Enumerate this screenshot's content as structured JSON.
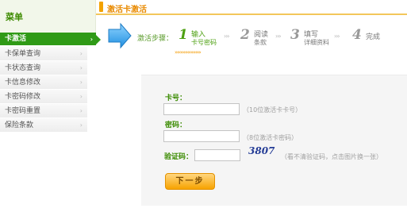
{
  "sidebar": {
    "title": "菜单",
    "items": [
      {
        "label": "卡激活"
      },
      {
        "label": "卡保单查询"
      },
      {
        "label": "卡状态查询"
      },
      {
        "label": "卡信息修改"
      },
      {
        "label": "卡密码修改"
      },
      {
        "label": "卡密码重置"
      },
      {
        "label": "保险条款"
      }
    ]
  },
  "header": {
    "title": "激活卡激活"
  },
  "steps": {
    "label": "激活步骤：",
    "items": [
      {
        "num": "1",
        "line1": "输入",
        "line2": "卡号密码"
      },
      {
        "num": "2",
        "line1": "阅读",
        "line2": "条款"
      },
      {
        "num": "3",
        "line1": "填写",
        "line2": "详细资料"
      },
      {
        "num": "4",
        "line1": "完成",
        "line2": ""
      }
    ],
    "progress": "»»»»»»»»»»"
  },
  "form": {
    "card_number": {
      "label": "卡号：",
      "value": "",
      "hint": "（10位激活卡卡号）"
    },
    "password": {
      "label": "密码：",
      "value": "",
      "hint": "（8位激活卡密码）"
    },
    "captcha": {
      "label": "验证码：",
      "value": "",
      "code": "3807",
      "hint": "（看不清验证码，点击图片换一张）"
    },
    "submit_label": "下一步"
  }
}
